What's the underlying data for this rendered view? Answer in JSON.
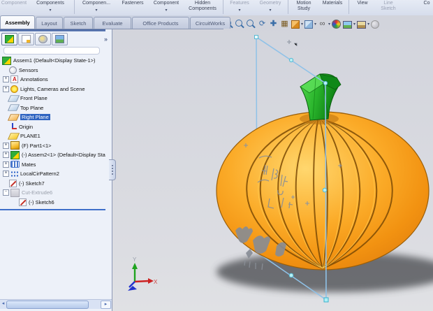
{
  "ribbon": {
    "buttons": [
      {
        "label": "Component",
        "grayed": true
      },
      {
        "label": "Components",
        "caret": true
      },
      {
        "label": "Componen...",
        "caret": true
      },
      {
        "label": "Fasteners"
      },
      {
        "label": "Component",
        "caret": true
      },
      {
        "label": "Hidden",
        "label2": "Components"
      },
      {
        "label": "Features",
        "caret": true,
        "grayed": true
      },
      {
        "label": "Geometry",
        "caret": true,
        "grayed": true
      },
      {
        "label": "Motion",
        "label2": "Study"
      },
      {
        "label": "Materials"
      },
      {
        "label": "View"
      },
      {
        "label": "Line",
        "label2": "Sketch",
        "grayed": true
      },
      {
        "label": "Co"
      }
    ]
  },
  "tabs": {
    "items": [
      {
        "label": "Assembly",
        "active": true
      },
      {
        "label": "Layout"
      },
      {
        "label": "Sketch"
      },
      {
        "label": "Evaluate"
      },
      {
        "label": "Office Products"
      },
      {
        "label": "CircuitWorks"
      }
    ]
  },
  "hud_toolbar": {
    "icons": [
      "zoom-to-fit",
      "zoom-to-area",
      "zoom-in-out",
      "rotate-view",
      "pan",
      "move-component",
      "assembly-xpert",
      "section-view",
      "view-orientation",
      "display-style",
      "hide-show-items",
      "edit-appearance",
      "apply-scene",
      "view-settings",
      "camera-disabled"
    ]
  },
  "panel": {
    "toolbar_icons": [
      "featuremanager-tab",
      "propertymanager-tab",
      "configurationmanager-tab",
      "displaymanager-tab"
    ],
    "overflow_chevron": "»",
    "tree": {
      "items": [
        {
          "label": "Assem1  (Default<Display State-1>)",
          "icon": "assembly"
        },
        {
          "label": "Sensors",
          "icon": "sensors"
        },
        {
          "label": "Annotations",
          "icon": "annotations",
          "expand": "+"
        },
        {
          "label": "Lights, Cameras and Scene",
          "icon": "lights",
          "expand": "+"
        },
        {
          "label": "Front Plane",
          "icon": "plane"
        },
        {
          "label": "Top Plane",
          "icon": "plane"
        },
        {
          "label": "Right Plane",
          "icon": "plane-selected",
          "selected": true
        },
        {
          "label": "Origin",
          "icon": "origin"
        },
        {
          "label": "PLANE1",
          "icon": "plane-gold"
        },
        {
          "label": "(F) Part1<1>",
          "icon": "part",
          "expand": "+"
        },
        {
          "label": "(-) Assem2<1> (Default<Display Sta",
          "icon": "assembly",
          "expand": "+"
        },
        {
          "label": "Mates",
          "icon": "mates",
          "expand": "+"
        },
        {
          "label": "LocalCirPattern2",
          "icon": "pattern",
          "expand": "+"
        },
        {
          "label": "(-) Sketch7",
          "icon": "sketch"
        },
        {
          "label": "Cut-Extrude6",
          "icon": "cut-extrude",
          "expand": "-",
          "grayed": true
        },
        {
          "label": "(-) Sketch6",
          "icon": "sketch"
        }
      ]
    },
    "hscroll": {
      "left_arrow": "◂",
      "right_arrow": "▸"
    }
  },
  "viewport": {
    "triad": {
      "x_label": "X",
      "y_label": "Y"
    },
    "model": "pumpkin-with-carving-sketch",
    "colors": {
      "background_top": "#d2d4dc",
      "background_bottom": "#e0e1e4",
      "pumpkin_main": "#f9a11b",
      "pumpkin_highlight": "#ffd76e",
      "pumpkin_dark": "#dd7a0e",
      "rib": "#7b4a05",
      "stem_green": "#2ab52c",
      "plane_outline": "#8fc2e8",
      "marker_fill": "#aef0f6",
      "selection_blue": "#2f64c1"
    }
  }
}
